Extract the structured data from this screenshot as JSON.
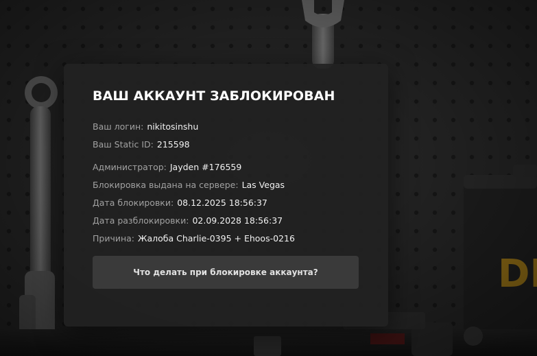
{
  "modal": {
    "title": "ВАШ АККАУНТ ЗАБЛОКИРОВАН",
    "login": {
      "label": "Ваш логин:",
      "value": "nikitosinshu"
    },
    "static_id": {
      "label": "Ваш Static ID:",
      "value": "215598"
    },
    "admin": {
      "label": "Администратор:",
      "value": "Jayden #176559"
    },
    "server": {
      "label": "Блокировка выдана на сервере:",
      "value": "Las Vegas"
    },
    "ban_date": {
      "label": "Дата блокировки:",
      "value": "08.12.2025 18:56:37"
    },
    "unban_date": {
      "label": "Дата разблокировки:",
      "value": "02.09.2028 18:56:37"
    },
    "reason": {
      "label": "Причина:",
      "value": "Жалоба Charlie-0395 + Ehoos-0216"
    },
    "help_button": "Что делать при блокировке аккаунта?"
  },
  "background": {
    "logo_text": "DE",
    "colors": {
      "base": "#1a1a1a",
      "wall": "#2b2b2b",
      "modal": "#212121",
      "button": "#3a3a3a",
      "logo": "#b5891b"
    }
  }
}
